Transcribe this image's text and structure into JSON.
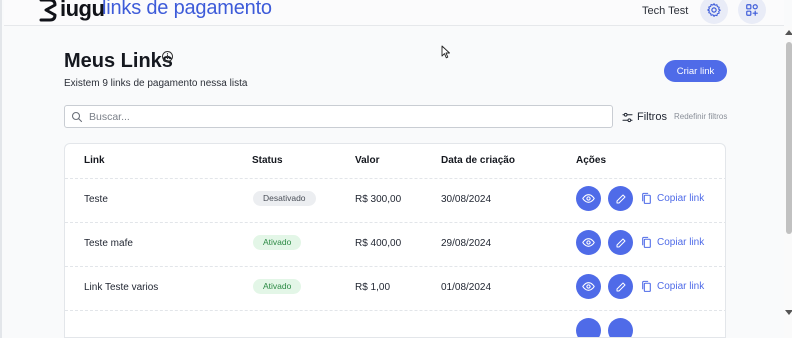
{
  "header": {
    "brand": "iugu",
    "product": "links de pagamento",
    "user_name": "Tech Test",
    "settings_icon": "gear-icon",
    "apps_icon": "apps-grid-icon"
  },
  "page": {
    "title": "Meus Links",
    "subtitle": "Existem 9 links de pagamento nessa lista",
    "create_button": "Criar link"
  },
  "search": {
    "placeholder": "Buscar...",
    "value": ""
  },
  "filters": {
    "label": "Filtros",
    "reset": "Redefinir filtros"
  },
  "table": {
    "columns": [
      "Link",
      "Status",
      "Valor",
      "Data de criação",
      "Ações"
    ],
    "rows": [
      {
        "link": "Teste",
        "status": "Desativado",
        "status_type": "inactive",
        "value": "R$ 300,00",
        "created": "30/08/2024",
        "copy": "Copiar link"
      },
      {
        "link": "Teste mafe",
        "status": "Ativado",
        "status_type": "active",
        "value": "R$ 400,00",
        "created": "29/08/2024",
        "copy": "Copiar link"
      },
      {
        "link": "Link Teste varios",
        "status": "Ativado",
        "status_type": "active",
        "value": "R$ 1,00",
        "created": "01/08/2024",
        "copy": "Copiar link"
      }
    ]
  },
  "colors": {
    "accent": "#4f6be8",
    "brand_text": "#3d5bd9",
    "active_badge_bg": "#e3f6e7",
    "active_badge_text": "#2c8a45",
    "inactive_badge_bg": "#eceef1"
  }
}
